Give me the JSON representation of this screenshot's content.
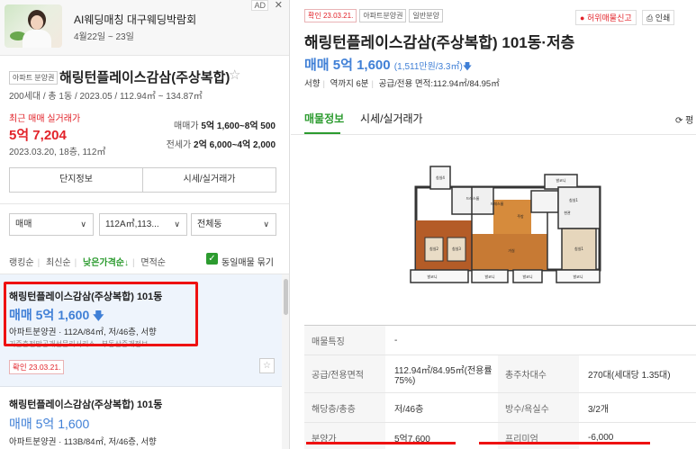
{
  "ad": {
    "tag": "AD",
    "close": "✕",
    "title": "AI웨딩매칭 대구웨딩박람회",
    "subtitle": "4월22일 ~ 23일"
  },
  "complex": {
    "type_badge": "아파트 분양권",
    "name": "해링턴플레이스감삼(주상복합)",
    "info": "200세대 / 총 1동 / 2023.05 / 112.94㎡ ~ 134.87㎡",
    "recent_label": "최근 매매 실거래가",
    "recent_price": "5억 7,204",
    "recent_date": "2023.03.20, 18층, 112㎡",
    "maemae_label": "매매가",
    "maemae_value": "5억 1,600~8억 500",
    "jeonse_label": "전세가",
    "jeonse_value": "2억 6,000~4억 2,000",
    "tab_info": "단지정보",
    "tab_trade": "시세/실거래가"
  },
  "filters": {
    "trade_type": "매매",
    "area": "112A㎡,113...",
    "dong": "전체동"
  },
  "sort": {
    "options": [
      "랭킹순",
      "최신순",
      "낮은가격순↓",
      "면적순"
    ],
    "same_listing": "동일매물 묶기"
  },
  "listings": [
    {
      "name": "해링턴플레이스감삼(주상복합) 101동",
      "price": "매매 5억 1,600",
      "desc": "아파트분양권 · 112A/84㎡, 저/46층, 서향",
      "desc2": "기준층전망공개선문리서리스 · 부동산중개정보",
      "confirm": "확인 23.03.21."
    },
    {
      "name": "해링턴플레이스감삼(주상복합) 101동",
      "price": "매매 5억 1,600",
      "desc": "아파트분양권 · 113B/84㎡, 저/46층, 서향"
    }
  ],
  "detail": {
    "badges": [
      "확인 23.03.21.",
      "아파트분양권",
      "일반분양"
    ],
    "report": "허위매물신고",
    "print": "인쇄",
    "title": "해링턴플레이스감삼(주상복합) 101동·저층",
    "price": "매매 5억 1,600",
    "unit_price": "(1,511만원/3.3㎡)",
    "meta": [
      "서향",
      "역까지 6분",
      "공급/전용 면적:112.94㎡/84.95㎡"
    ],
    "tab_listing": "매물정보",
    "tab_trade": "시세/실거래가",
    "refresh": "⟳ 평"
  },
  "floorplan_rooms": [
    "침실4",
    "침실1",
    "드레스룸",
    "현관",
    "거실",
    "주방",
    "침실2",
    "침실3",
    "침실1",
    "발코니",
    "발코니",
    "발코니",
    "발코니",
    "발코니",
    "드레스룸"
  ],
  "table": [
    {
      "l1": "매물특징",
      "v1": "-",
      "l2": "",
      "v2": ""
    },
    {
      "l1": "공급/전용면적",
      "v1": "112.94㎡/84.95㎡(전용률75%)",
      "l2": "총주차대수",
      "v2": "270대(세대당 1.35대)"
    },
    {
      "l1": "해당층/총층",
      "v1": "저/46층",
      "l2": "방수/욕실수",
      "v2": "3/2개"
    },
    {
      "l1": "분양가",
      "v1": "5억7,600",
      "l2": "프리미엄",
      "v2": "-6,000"
    }
  ]
}
